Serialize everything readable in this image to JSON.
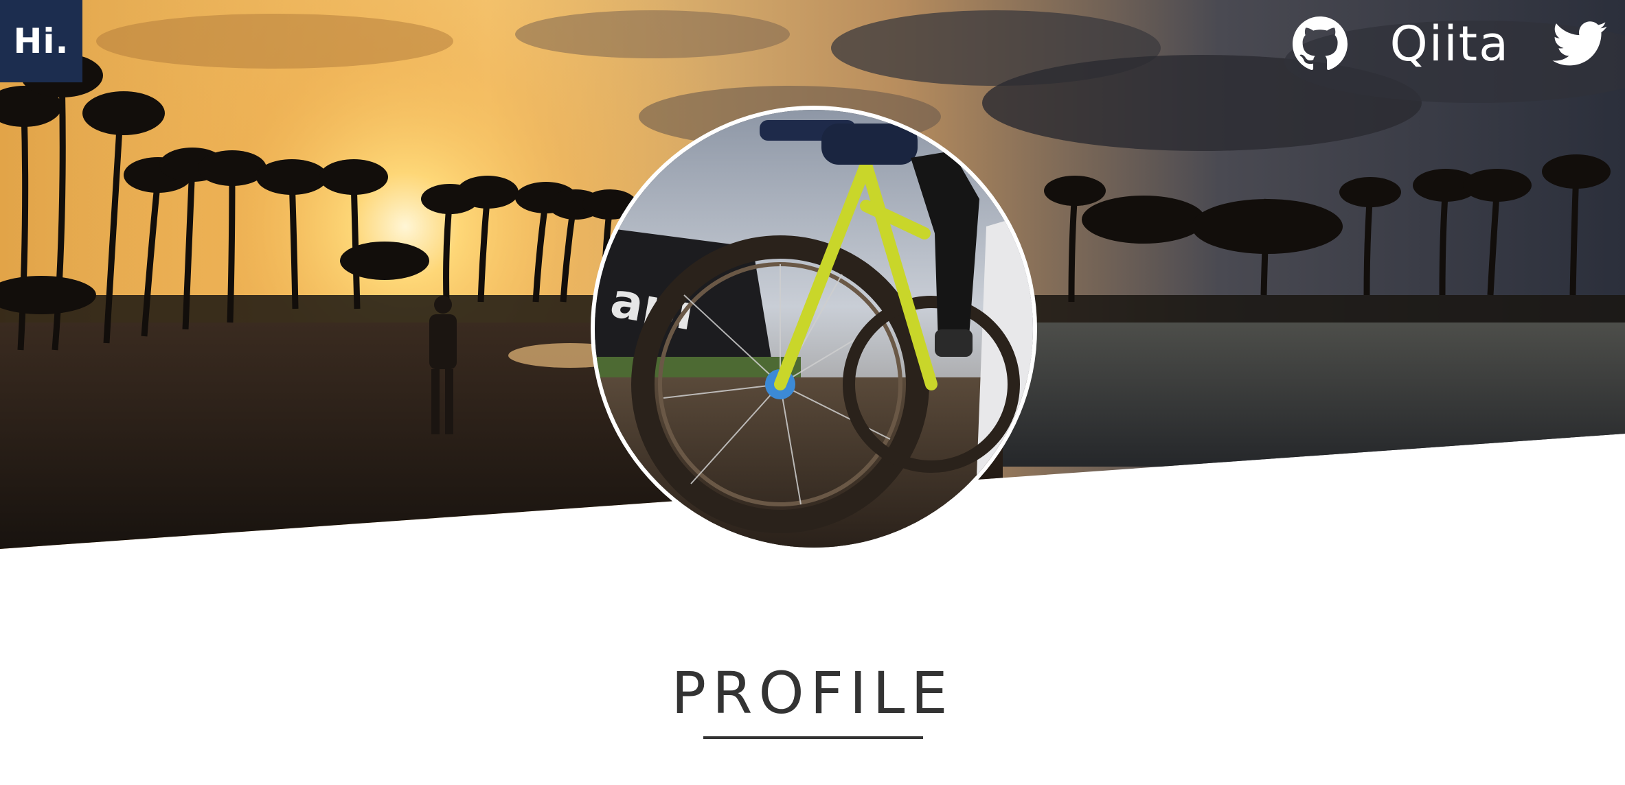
{
  "header": {
    "logo_text": "Hi.",
    "social_links": [
      {
        "name": "github",
        "icon": "github-icon"
      },
      {
        "name": "qiita",
        "label": "Qiita"
      },
      {
        "name": "twitter",
        "icon": "twitter-icon"
      }
    ]
  },
  "main": {
    "section_title": "PROFILE"
  },
  "colors": {
    "logo_bg": "#1c2d4f",
    "title_text": "#333333",
    "icon_fill": "#ffffff"
  }
}
